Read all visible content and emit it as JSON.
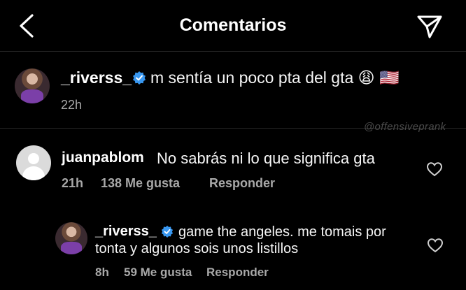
{
  "header": {
    "title": "Comentarios"
  },
  "caption": {
    "username": "_riverss_",
    "text": "m sentía un poco pta del gta 😩 🇺🇸",
    "time": "22h"
  },
  "watermark": "@offensiveprank",
  "comments": [
    {
      "username": "juanpablom",
      "text": "No sabrás ni lo que significa gta",
      "time": "21h",
      "likes": "138 Me gusta",
      "reply_label": "Responder"
    }
  ],
  "replies": [
    {
      "username": "_riverss_",
      "text_line1": "game the angeles. me tomais por",
      "text_line2": "tonta y algunos sois unos listillos",
      "time": "8h",
      "likes": "59 Me gusta",
      "reply_label": "Responder"
    }
  ],
  "colors": {
    "background": "#000000",
    "verified": "#3897f0",
    "secondary_text": "#a8a8a8"
  }
}
